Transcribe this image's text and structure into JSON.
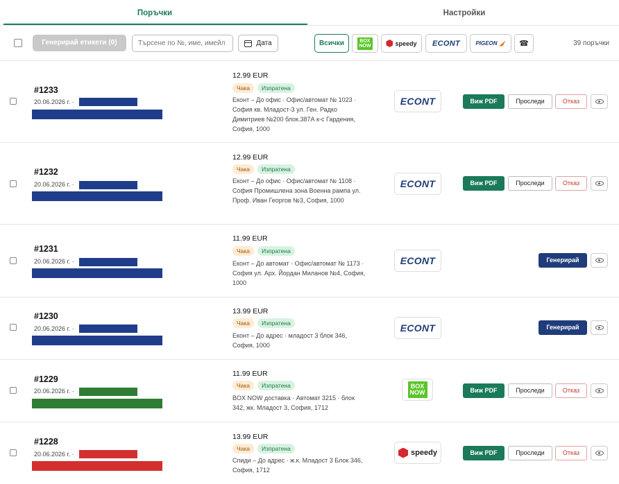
{
  "tabs": [
    {
      "label": "Поръчки",
      "active": true
    },
    {
      "label": "Настройки",
      "active": false
    }
  ],
  "toolbar": {
    "generate_labels": "Генерирай етикети (0)",
    "search_placeholder": "Търсене по №, име, имейл",
    "date_label": "Дата",
    "filters": {
      "all": "Всички",
      "boxnow_line1": "BOX",
      "boxnow_line2": "NOW",
      "speedy": "speedy",
      "econt": "ECONT",
      "pigeon": "PIGEON",
      "phone_icon": "☎"
    },
    "orders_count": "39 поръчки"
  },
  "colors": {
    "accent": "#1a7a5a",
    "navy": "#1f3d7a",
    "bar_blue": "#1f3d8a",
    "bar_green": "#2e7d32",
    "bar_red": "#d32f2f"
  },
  "labels": {
    "view_pdf": "Виж PDF",
    "track": "Проследи",
    "cancel": "Отказ",
    "generate": "Генерирай",
    "status_wait": "Чака",
    "status_sent": "Изпратена"
  },
  "orders": [
    {
      "number": "#1233",
      "date": "20.06.2026 г. ·",
      "bar_color": "#1f3d8a",
      "price": "12.99 EUR",
      "address": "Еконт – До офис · Офис/автомат № 1023 · София кв. Младост-3 ул. Ген. Радко Димитриев №200 блок.387А к-с Гардения, София, 1000",
      "carrier": "econt",
      "carrier_text": "ECONT",
      "actions": "full"
    },
    {
      "number": "#1232",
      "date": "20.06.2026 г. ·",
      "bar_color": "#1f3d8a",
      "price": "12.99 EUR",
      "address": "Еконт – До офис · Офис/автомат № 1108 · София Промишлена зона Военна рампа ул. Проф. Иван Георгов №3, София, 1000",
      "carrier": "econt",
      "carrier_text": "ECONT",
      "actions": "full"
    },
    {
      "number": "#1231",
      "date": "20.06.2026 г. ·",
      "bar_color": "#1f3d8a",
      "price": "11.99 EUR",
      "address": "Еконт – До автомат · Офис/автомат № 1173 · София ул. Арх. Йордан Миланов №4, София, 1000",
      "carrier": "econt",
      "carrier_text": "ECONT",
      "actions": "generate"
    },
    {
      "number": "#1230",
      "date": "20.06.2026 г. ·",
      "bar_color": "#1f3d8a",
      "price": "13.99 EUR",
      "address": "Еконт – До адрес · младост 3 блок 346, София, 1000",
      "carrier": "econt",
      "carrier_text": "ECONT",
      "actions": "generate"
    },
    {
      "number": "#1229",
      "date": "20.06.2026 г. ·",
      "bar_color": "#2e7d32",
      "price": "11.99 EUR",
      "address": "BOX NOW доставка · Автомат 3215 · блок 342, жк. Младост 3, София, 1712",
      "carrier": "boxnow",
      "carrier_text": "BOX NOW",
      "actions": "full"
    },
    {
      "number": "#1228",
      "date": "20.06.2026 г. ·",
      "bar_color": "#d32f2f",
      "price": "13.99 EUR",
      "address": "Спиди – До адрес · ж.к. Младост 3 Блок 346, София, 1712",
      "carrier": "speedy",
      "carrier_text": "speedy",
      "actions": "full"
    }
  ]
}
